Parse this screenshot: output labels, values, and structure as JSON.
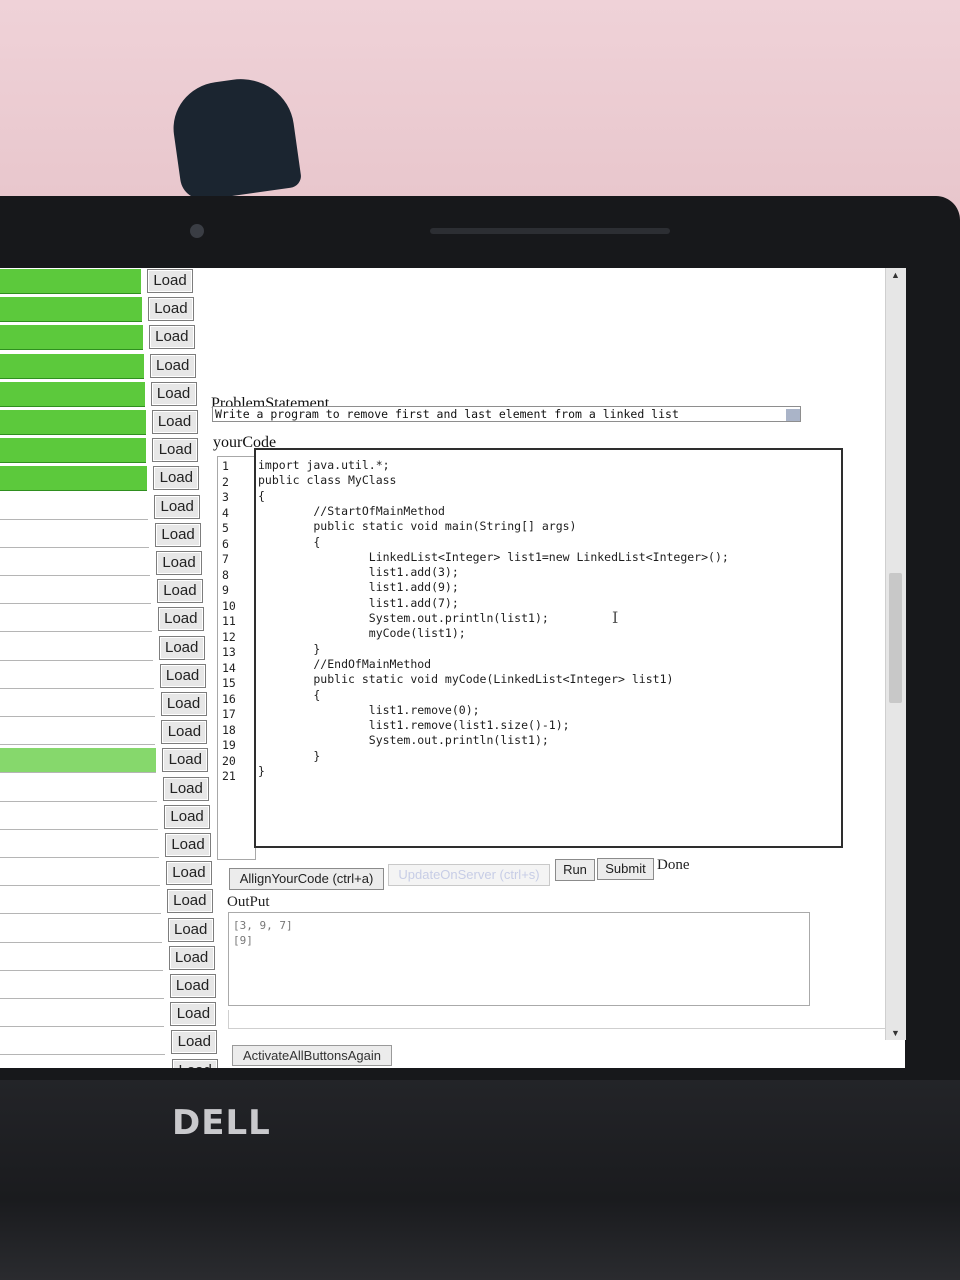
{
  "load_list": {
    "button_label": "Load",
    "rows": [
      {
        "status": "done"
      },
      {
        "status": "done"
      },
      {
        "status": "done"
      },
      {
        "status": "done"
      },
      {
        "status": "done"
      },
      {
        "status": "done"
      },
      {
        "status": "done"
      },
      {
        "status": "done"
      },
      {
        "status": "none"
      },
      {
        "status": "none"
      },
      {
        "status": "none"
      },
      {
        "status": "none"
      },
      {
        "status": "none"
      },
      {
        "status": "none"
      },
      {
        "status": "none"
      },
      {
        "status": "none"
      },
      {
        "status": "none"
      },
      {
        "status": "active"
      },
      {
        "status": "none"
      },
      {
        "status": "none"
      },
      {
        "status": "none"
      },
      {
        "status": "none"
      },
      {
        "status": "none"
      },
      {
        "status": "none"
      },
      {
        "status": "none"
      },
      {
        "status": "none"
      },
      {
        "status": "none"
      },
      {
        "status": "none"
      },
      {
        "status": "none"
      },
      {
        "status": "none"
      }
    ],
    "done_color": "#5cc93c",
    "active_color": "#86d86c"
  },
  "problem": {
    "label": "ProblemStatement",
    "text": "Write a program to remove first and last element from a linked list"
  },
  "editor": {
    "label": "yourCode",
    "line_numbers": [
      "1",
      "2",
      "3",
      "4",
      "5",
      "6",
      "7",
      "8",
      "9",
      "10",
      "11",
      "12",
      "13",
      "14",
      "15",
      "16",
      "17",
      "18",
      "19",
      "20",
      "21"
    ],
    "lines": [
      "import java.util.*;",
      "public class MyClass",
      "{",
      "        //StartOfMainMethod",
      "        public static void main(String[] args)",
      "        {",
      "                LinkedList<Integer> list1=new LinkedList<Integer>();",
      "                list1.add(3);",
      "                list1.add(9);",
      "                list1.add(7);",
      "                System.out.println(list1);",
      "                myCode(list1);",
      "        }",
      "        //EndOfMainMethod",
      "        public static void myCode(LinkedList<Integer> list1)",
      "        {",
      "                list1.remove(0);",
      "                list1.remove(list1.size()-1);",
      "                System.out.println(list1);",
      "        }",
      "}"
    ]
  },
  "toolbar": {
    "align_label": "AllignYourCode (ctrl+a)",
    "update_label": "UpdateOnServer (ctrl+s)",
    "run_label": "Run",
    "submit_label": "Submit",
    "status_text": "Done"
  },
  "output": {
    "label": "OutPut",
    "lines": [
      "[3, 9, 7]",
      "[9]"
    ]
  },
  "footer": {
    "activate_label": "ActivateAllButtonsAgain"
  },
  "device": {
    "brand": "DELL"
  }
}
